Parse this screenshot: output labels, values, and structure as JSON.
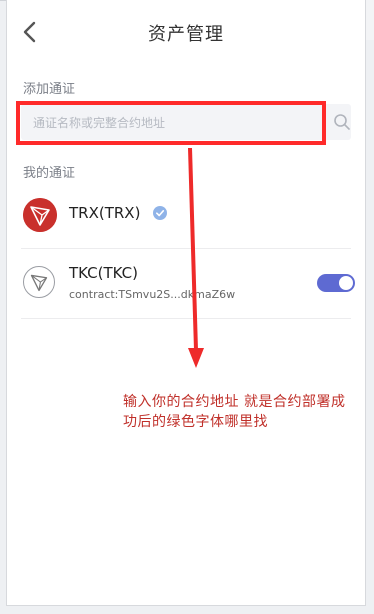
{
  "header": {
    "title": "资产管理"
  },
  "add_section": {
    "label": "添加通证",
    "search_placeholder": "通证名称或完整合约地址"
  },
  "my_tokens": {
    "label": "我的通证",
    "items": [
      {
        "name": "TRX(TRX)",
        "verified": true
      },
      {
        "name": "TKC(TKC)",
        "contract": "contract:TSmvu2S...dkmaZ6w",
        "enabled": true
      }
    ]
  },
  "annotation": {
    "line1": "输入你的合约地址 就是合约部署成",
    "line2": "功后的绿色字体哪里找",
    "color": "#c0302a"
  },
  "colors": {
    "accent": "#5e6ad2",
    "trx_red": "#c9302c",
    "highlight_red": "#ff2a2a"
  }
}
